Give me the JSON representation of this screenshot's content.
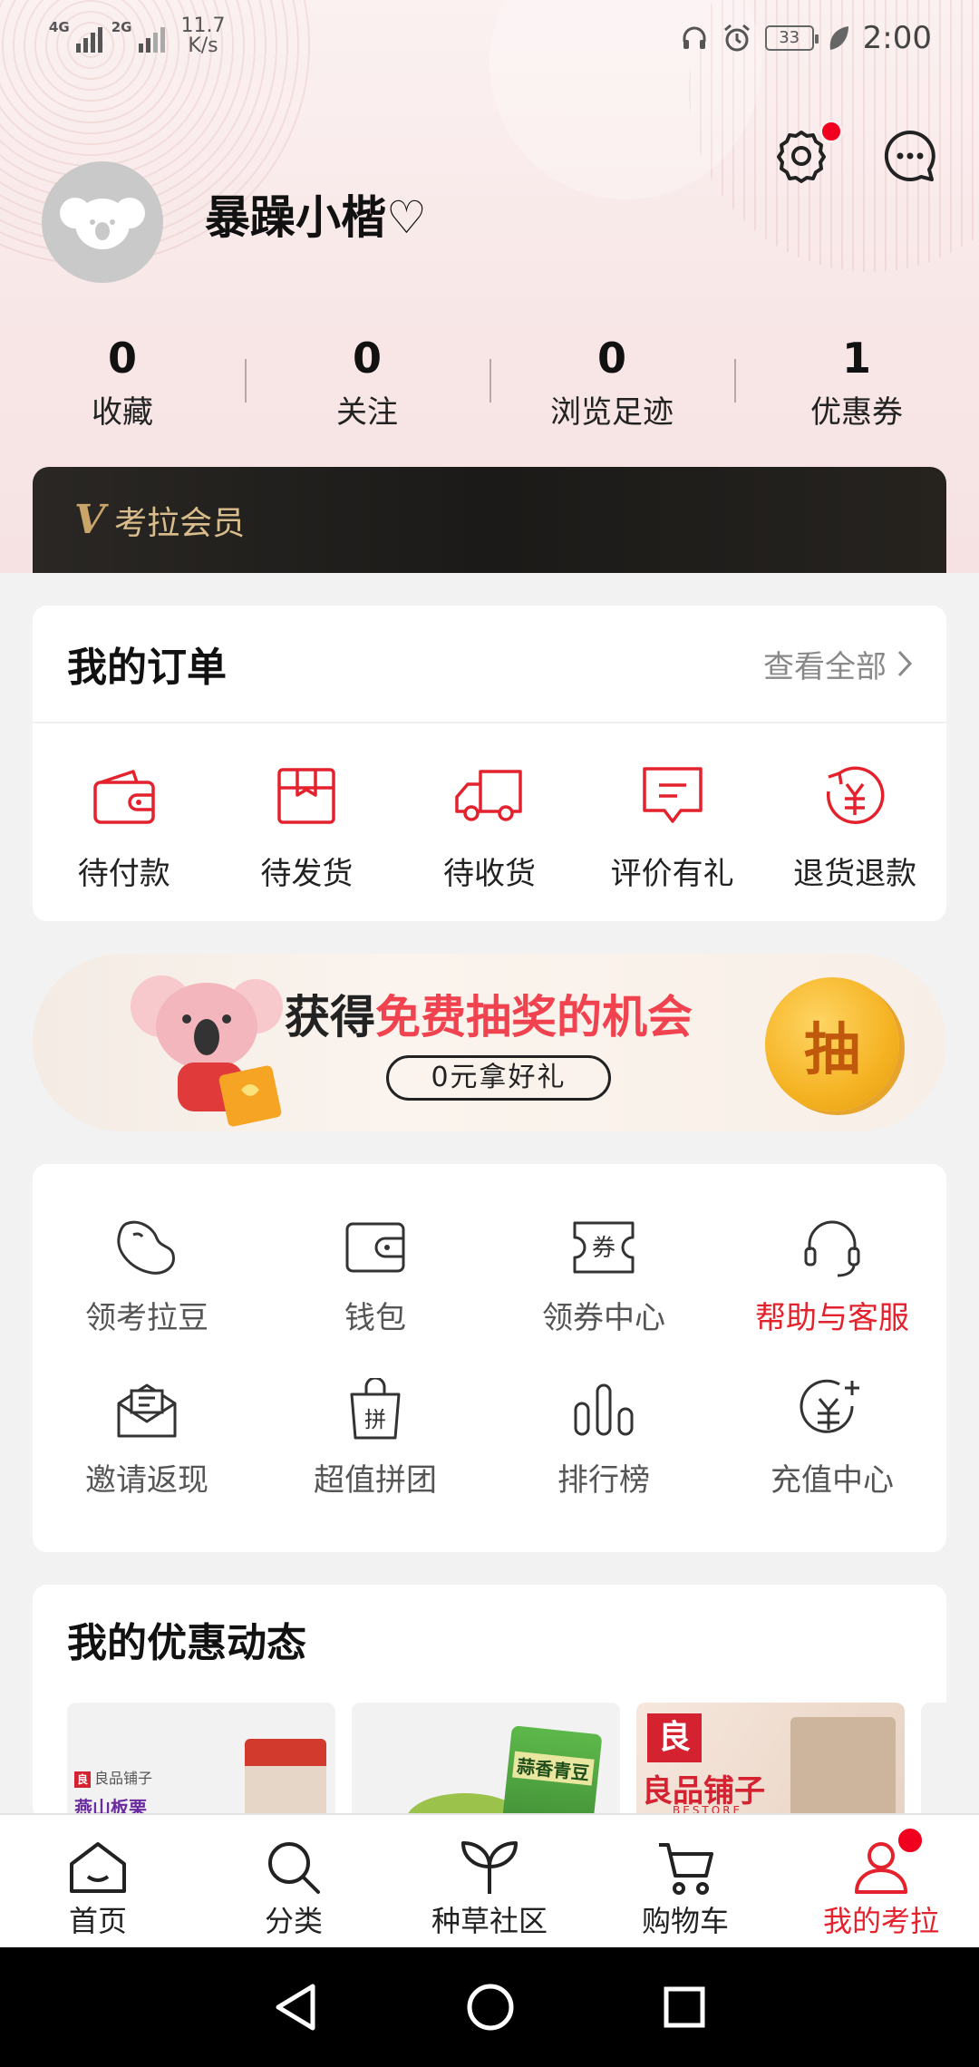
{
  "status_bar": {
    "signal1": "4G",
    "signal2": "2G",
    "net_speed_value": "11.7",
    "net_speed_unit": "K/s",
    "battery": "33",
    "time": "2:00"
  },
  "profile": {
    "username": "暴躁小楷♡",
    "stats": [
      {
        "num": "0",
        "label": "收藏"
      },
      {
        "num": "0",
        "label": "关注"
      },
      {
        "num": "0",
        "label": "浏览足迹"
      },
      {
        "num": "1",
        "label": "优惠券"
      }
    ],
    "member_label": "考拉会员",
    "member_badge": "V"
  },
  "orders": {
    "title": "我的订单",
    "view_all": "查看全部",
    "items": [
      {
        "label": "待付款",
        "icon": "wallet-icon"
      },
      {
        "label": "待发货",
        "icon": "box-icon"
      },
      {
        "label": "待收货",
        "icon": "truck-icon"
      },
      {
        "label": "评价有礼",
        "icon": "comment-icon"
      },
      {
        "label": "退货退款",
        "icon": "refund-icon"
      }
    ]
  },
  "banner": {
    "prefix": "获得",
    "highlight": "免费抽奖的机会",
    "pill": "0元拿好礼",
    "coin": "抽"
  },
  "services": {
    "items": [
      {
        "label": "领考拉豆",
        "icon": "bean-icon"
      },
      {
        "label": "钱包",
        "icon": "wallet-icon"
      },
      {
        "label": "领券中心",
        "icon": "coupon-icon",
        "glyph": "券"
      },
      {
        "label": "帮助与客服",
        "icon": "headset-icon"
      },
      {
        "label": "邀请返现",
        "icon": "invite-icon"
      },
      {
        "label": "超值拼团",
        "icon": "group-buy-icon",
        "glyph": "拼"
      },
      {
        "label": "排行榜",
        "icon": "ranking-icon"
      },
      {
        "label": "充值中心",
        "icon": "recharge-icon"
      }
    ]
  },
  "promo": {
    "title": "我的优惠动态",
    "thumbs": [
      {
        "store_tag": "良品铺子",
        "product": "燕山板栗",
        "tag_glyph": "良"
      },
      {
        "product": "蒜香青豆"
      },
      {
        "brand": "良品铺子",
        "brand_sub": "BESTORE",
        "brand_glyph": "良"
      }
    ]
  },
  "tabs": [
    {
      "label": "首页",
      "icon": "home-icon"
    },
    {
      "label": "分类",
      "icon": "search-icon"
    },
    {
      "label": "种草社区",
      "icon": "sprout-icon"
    },
    {
      "label": "购物车",
      "icon": "cart-icon"
    },
    {
      "label": "我的考拉",
      "icon": "user-icon",
      "active": true
    }
  ],
  "colors": {
    "accent": "#e3222d",
    "notify_dot": "#f0001e",
    "member_gold": "#d9bd8c"
  }
}
